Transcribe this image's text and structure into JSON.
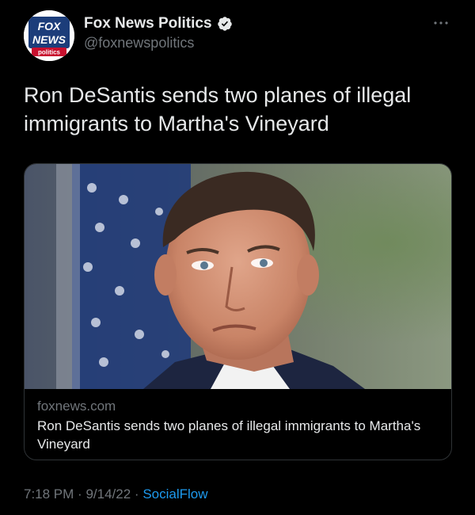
{
  "tweet": {
    "author": {
      "display_name": "Fox News Politics",
      "handle": "@foxnewspolitics",
      "verified": true,
      "avatar": {
        "line1": "FOX",
        "line2": "NEWS",
        "line3": "politics"
      }
    },
    "more_icon": "more-horizontal-icon",
    "text": "Ron DeSantis sends two planes of illegal immigrants to Martha's Vineyard",
    "card": {
      "domain": "foxnews.com",
      "title": "Ron DeSantis sends two planes of illegal immigrants to Martha's Vineyard"
    },
    "footer": {
      "time": "7:18 PM",
      "separator1": "·",
      "date": "9/14/22",
      "separator2": "·",
      "source": "SocialFlow"
    }
  },
  "colors": {
    "background": "#000000",
    "primary_text": "#e7e9ea",
    "secondary_text": "#71767b",
    "link": "#1d9bf0",
    "border": "#2f3336",
    "verified": "#1d9bf0"
  }
}
